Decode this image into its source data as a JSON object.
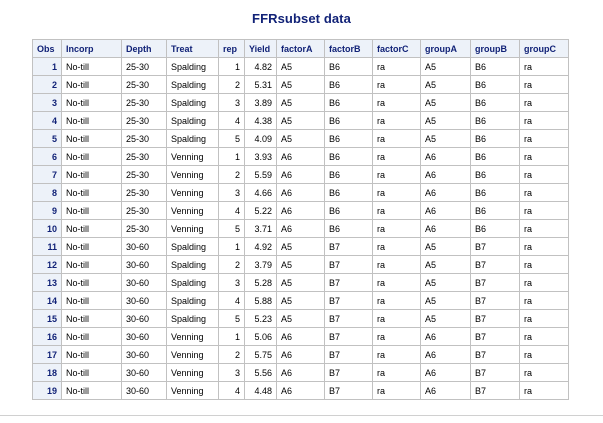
{
  "title": "FFRsubset data",
  "table": {
    "columns": [
      "Obs",
      "Incorp",
      "Depth",
      "Treat",
      "rep",
      "Yield",
      "factorA",
      "factorB",
      "factorC",
      "groupA",
      "groupB",
      "groupC"
    ],
    "rows": [
      [
        "1",
        "No-till",
        "25-30",
        "Spalding",
        "1",
        "4.82",
        "A5",
        "B6",
        "ra",
        "A5",
        "B6",
        "ra"
      ],
      [
        "2",
        "No-till",
        "25-30",
        "Spalding",
        "2",
        "5.31",
        "A5",
        "B6",
        "ra",
        "A5",
        "B6",
        "ra"
      ],
      [
        "3",
        "No-till",
        "25-30",
        "Spalding",
        "3",
        "3.89",
        "A5",
        "B6",
        "ra",
        "A5",
        "B6",
        "ra"
      ],
      [
        "4",
        "No-till",
        "25-30",
        "Spalding",
        "4",
        "4.38",
        "A5",
        "B6",
        "ra",
        "A5",
        "B6",
        "ra"
      ],
      [
        "5",
        "No-till",
        "25-30",
        "Spalding",
        "5",
        "4.09",
        "A5",
        "B6",
        "ra",
        "A5",
        "B6",
        "ra"
      ],
      [
        "6",
        "No-till",
        "25-30",
        "Venning",
        "1",
        "3.93",
        "A6",
        "B6",
        "ra",
        "A6",
        "B6",
        "ra"
      ],
      [
        "7",
        "No-till",
        "25-30",
        "Venning",
        "2",
        "5.59",
        "A6",
        "B6",
        "ra",
        "A6",
        "B6",
        "ra"
      ],
      [
        "8",
        "No-till",
        "25-30",
        "Venning",
        "3",
        "4.66",
        "A6",
        "B6",
        "ra",
        "A6",
        "B6",
        "ra"
      ],
      [
        "9",
        "No-till",
        "25-30",
        "Venning",
        "4",
        "5.22",
        "A6",
        "B6",
        "ra",
        "A6",
        "B6",
        "ra"
      ],
      [
        "10",
        "No-till",
        "25-30",
        "Venning",
        "5",
        "3.71",
        "A6",
        "B6",
        "ra",
        "A6",
        "B6",
        "ra"
      ],
      [
        "11",
        "No-till",
        "30-60",
        "Spalding",
        "1",
        "4.92",
        "A5",
        "B7",
        "ra",
        "A5",
        "B7",
        "ra"
      ],
      [
        "12",
        "No-till",
        "30-60",
        "Spalding",
        "2",
        "3.79",
        "A5",
        "B7",
        "ra",
        "A5",
        "B7",
        "ra"
      ],
      [
        "13",
        "No-till",
        "30-60",
        "Spalding",
        "3",
        "5.28",
        "A5",
        "B7",
        "ra",
        "A5",
        "B7",
        "ra"
      ],
      [
        "14",
        "No-till",
        "30-60",
        "Spalding",
        "4",
        "5.88",
        "A5",
        "B7",
        "ra",
        "A5",
        "B7",
        "ra"
      ],
      [
        "15",
        "No-till",
        "30-60",
        "Spalding",
        "5",
        "5.23",
        "A5",
        "B7",
        "ra",
        "A5",
        "B7",
        "ra"
      ],
      [
        "16",
        "No-till",
        "30-60",
        "Venning",
        "1",
        "5.06",
        "A6",
        "B7",
        "ra",
        "A6",
        "B7",
        "ra"
      ],
      [
        "17",
        "No-till",
        "30-60",
        "Venning",
        "2",
        "5.75",
        "A6",
        "B7",
        "ra",
        "A6",
        "B7",
        "ra"
      ],
      [
        "18",
        "No-till",
        "30-60",
        "Venning",
        "3",
        "5.56",
        "A6",
        "B7",
        "ra",
        "A6",
        "B7",
        "ra"
      ],
      [
        "19",
        "No-till",
        "30-60",
        "Venning",
        "4",
        "4.48",
        "A6",
        "B7",
        "ra",
        "A6",
        "B7",
        "ra"
      ]
    ]
  }
}
